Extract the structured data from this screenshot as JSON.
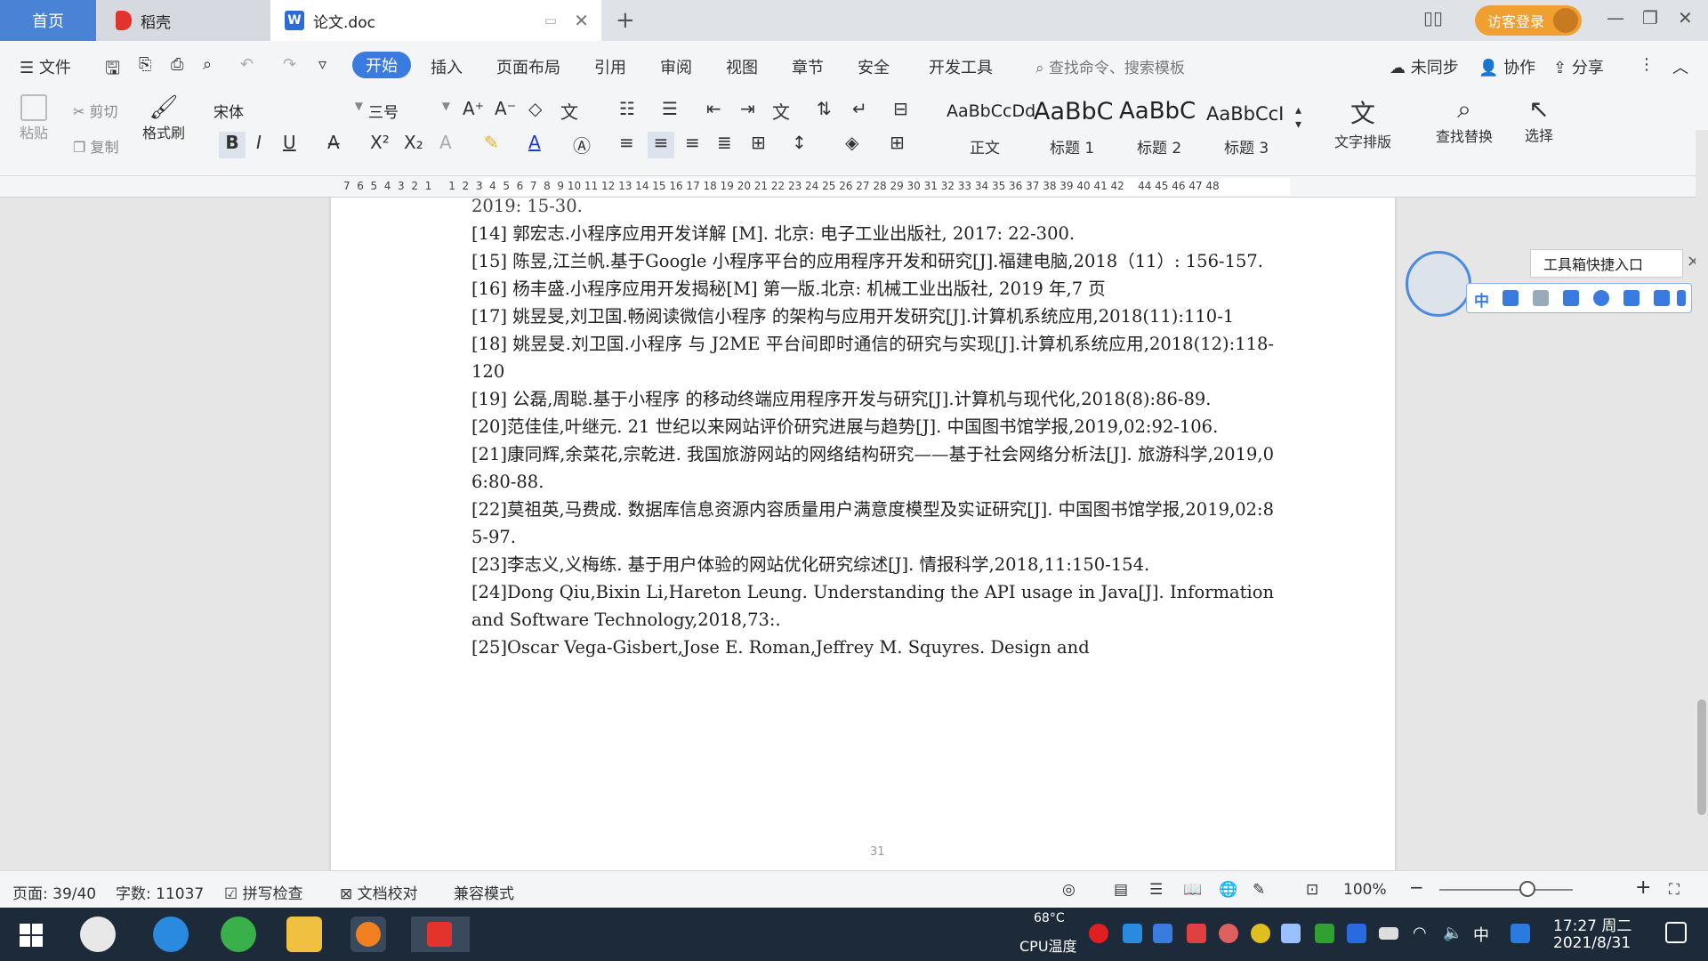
{
  "tabs": {
    "home": "首页",
    "daoke": "稻壳",
    "doc": "论文.doc",
    "login": "访客登录"
  },
  "menu": {
    "file": "文件",
    "items": [
      "开始",
      "插入",
      "页面布局",
      "引用",
      "审阅",
      "视图",
      "章节",
      "安全",
      "开发工具"
    ],
    "search_placeholder": "查找命令、搜索模板",
    "unsynced": "未同步",
    "collab": "协作",
    "share": "分享"
  },
  "ribbon": {
    "paste": "粘贴",
    "cut": "剪切",
    "copy": "复制",
    "format_painter": "格式刷",
    "font_name": "宋体",
    "font_size": "三号",
    "styles": [
      {
        "sample": "AaBbCcDd",
        "label": "正文"
      },
      {
        "sample": "AaBbC",
        "label": "标题 1"
      },
      {
        "sample": "AaBbC",
        "label": "标题 2"
      },
      {
        "sample": "AaBbCcI",
        "label": "标题 3"
      }
    ],
    "text_layout": "文字排版",
    "find_replace": "查找替换",
    "select": "选择"
  },
  "ruler": {
    "numbers": "7  6  5  4  3  2  1     1  2  3  4  5  6  7  8  9 10 11 12 13 14 15 16 17 18 19 20 21 22 23 24 25 26 27 28 29 30 31 32 33 34 35 36 37 38 39 40 41 42    44 45 46 47 48"
  },
  "document": {
    "lines": [
      "2019: 15-30.",
      "[14] 郭宏志.小程序应用开发详解 [M]. 北京: 电子工业出版社, 2017: 22-300.",
      "[15] 陈昱,江兰帆.基于Google 小程序平台的应用程序开发和研究[J].福建电脑,2018（11）: 156-157.",
      "[16] 杨丰盛.小程序应用开发揭秘[M] 第一版.北京: 机械工业出版社, 2019 年,7 页",
      "[17] 姚昱旻,刘卫国.畅阅读微信小程序 的架构与应用开发研究[J].计算机系统应用,2018(11):110-1",
      "[18] 姚昱旻.刘卫国.小程序 与 J2ME 平台间即时通信的研究与实现[J].计算机系统应用,2018(12):118-120",
      "[19] 公磊,周聪.基于小程序 的移动终端应用程序开发与研究[J].计算机与现代化,2018(8):86-89.",
      "[20]范佳佳,叶继元. 21 世纪以来网站评价研究进展与趋势[J]. 中国图书馆学报,2019,02:92-106.",
      "[21]康同辉,余菜花,宗乾进. 我国旅游网站的网络结构研究——基于社会网络分析法[J]. 旅游科学,2019,06:80-88.",
      "[22]莫祖英,马费成. 数据库信息资源内容质量用户满意度模型及实证研究[J]. 中国图书馆学报,2019,02:85-97.",
      "[23]李志义,义梅练. 基于用户体验的网站优化研究综述[J]. 情报科学,2018,11:150-154.",
      "[24]Dong Qiu,Bixin Li,Hareton Leung. Understanding the API usage in Java[J]. Information and Software Technology,2018,73:.",
      "[25]Oscar  Vega-Gisbert,Jose  E.  Roman,Jeffrey  M.  Squyres.  Design  and"
    ],
    "page_number": "31"
  },
  "toolbox": {
    "tip": "工具箱快捷入口",
    "first_icon": "中"
  },
  "status": {
    "page": "页面: 39/40",
    "words": "字数: 11037",
    "spell": "拼写检查",
    "proof": "文档校对",
    "compat": "兼容模式",
    "zoom": "100%"
  },
  "taskbar": {
    "cpu_temp": "68°C",
    "cpu_label": "CPU温度",
    "ime": "中",
    "time": "17:27 周二",
    "date": "2021/8/31"
  },
  "colors": {
    "accent": "#3a7be0",
    "login": "#f0a030",
    "taskbar": "#1c2a3a"
  }
}
